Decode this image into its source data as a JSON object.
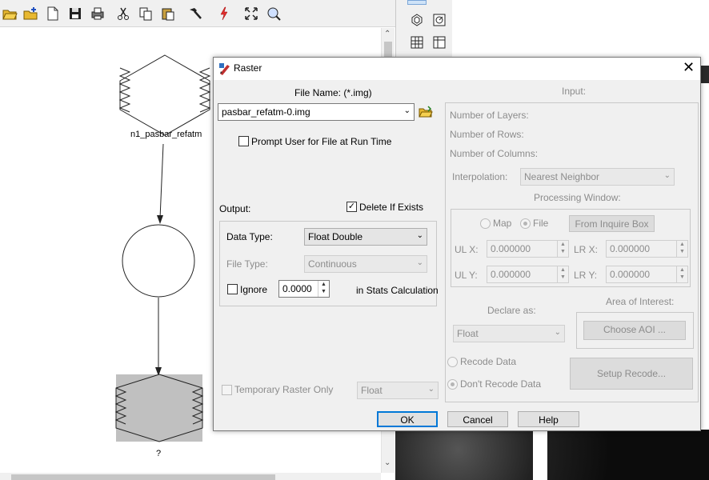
{
  "dialog": {
    "title": "Raster",
    "filename_label": "File Name: (*.img)",
    "filename_value": "pasbar_refatm-0.img",
    "prompt_label": "Prompt User for File at Run Time",
    "output_label": "Output:",
    "delete_label": "Delete If Exists",
    "data_type_label": "Data Type:",
    "data_type_value": "Float Double",
    "file_type_label": "File Type:",
    "file_type_value": "Continuous",
    "ignore_label": "Ignore",
    "ignore_value": "0.0000",
    "stats_label": "in Stats Calculation",
    "temp_label": "Temporary Raster Only",
    "temp_type_value": "Float",
    "input_label": "Input:",
    "num_layers": "Number of Layers:",
    "num_rows": "Number of Rows:",
    "num_cols": "Number of Columns:",
    "interp_label": "Interpolation:",
    "interp_value": "Nearest Neighbor",
    "proc_window_label": "Processing Window:",
    "map_label": "Map",
    "file_label": "File",
    "inquire_button": "From Inquire Box",
    "ulx_label": "UL X:",
    "ulx_value": "0.000000",
    "lrx_label": "LR X:",
    "lrx_value": "0.000000",
    "uly_label": "UL Y:",
    "uly_value": "0.000000",
    "lry_label": "LR Y:",
    "lry_value": "0.000000",
    "declare_label": "Declare as:",
    "declare_value": "Float",
    "aoi_label": "Area of Interest:",
    "aoi_button": "Choose AOI ...",
    "recode_label": "Recode Data",
    "norecode_label": "Don't Recode Data",
    "setup_recode_button": "Setup Recode...",
    "ok_button": "OK",
    "cancel_button": "Cancel",
    "help_button": "Help"
  },
  "model": {
    "node1_label": "n1_pasbar_refatm",
    "node3_label": "?"
  },
  "icons": [
    "open-folder-icon",
    "new-folder-icon",
    "new-file-icon",
    "save-icon",
    "print-icon",
    "cut-icon",
    "copy-icon",
    "paste-icon",
    "hammer-icon",
    "lightning-icon",
    "zoom-fit-icon",
    "zoom-icon",
    "stack-icon",
    "chart-icon",
    "grid-icon",
    "table-icon",
    "browse-folder-icon",
    "close-icon",
    "raster-app-icon"
  ],
  "colors": {
    "accent": "#0078d7",
    "disabled_text": "#8c8c8c",
    "node_fill": "#c0c0c0"
  }
}
